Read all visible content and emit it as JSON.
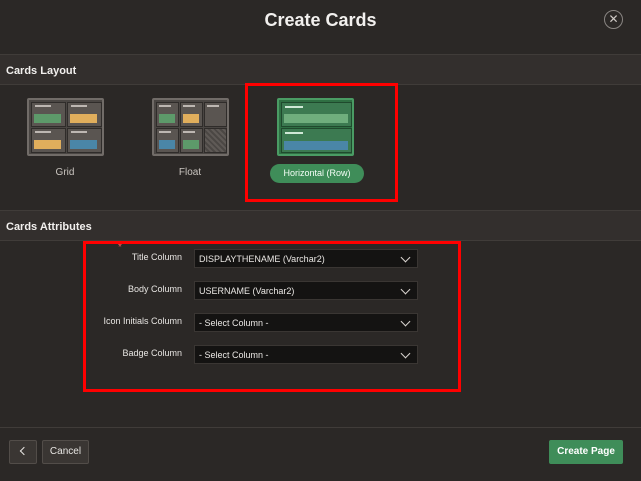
{
  "dialog": {
    "title": "Create Cards",
    "close_icon": "close-icon"
  },
  "layout_section": {
    "heading": "Cards Layout",
    "options": [
      {
        "label": "Grid",
        "selected": false
      },
      {
        "label": "Float",
        "selected": false
      },
      {
        "label": "Horizontal (Row)",
        "selected": true
      }
    ]
  },
  "attributes_section": {
    "heading": "Cards Attributes",
    "fields": [
      {
        "label": "Title Column",
        "value": "DISPLAYTHENAME (Varchar2)",
        "required": true
      },
      {
        "label": "Body Column",
        "value": "USERNAME (Varchar2)",
        "required": false
      },
      {
        "label": "Icon Initials Column",
        "value": "- Select Column -",
        "required": false
      },
      {
        "label": "Badge Column",
        "value": "- Select Column -",
        "required": false
      }
    ]
  },
  "footer": {
    "back_icon": "chevron-left-icon",
    "cancel_label": "Cancel",
    "create_label": "Create Page"
  },
  "colors": {
    "accent": "#3f8d59",
    "highlight": "#ff0000",
    "background": "#2b2826"
  }
}
